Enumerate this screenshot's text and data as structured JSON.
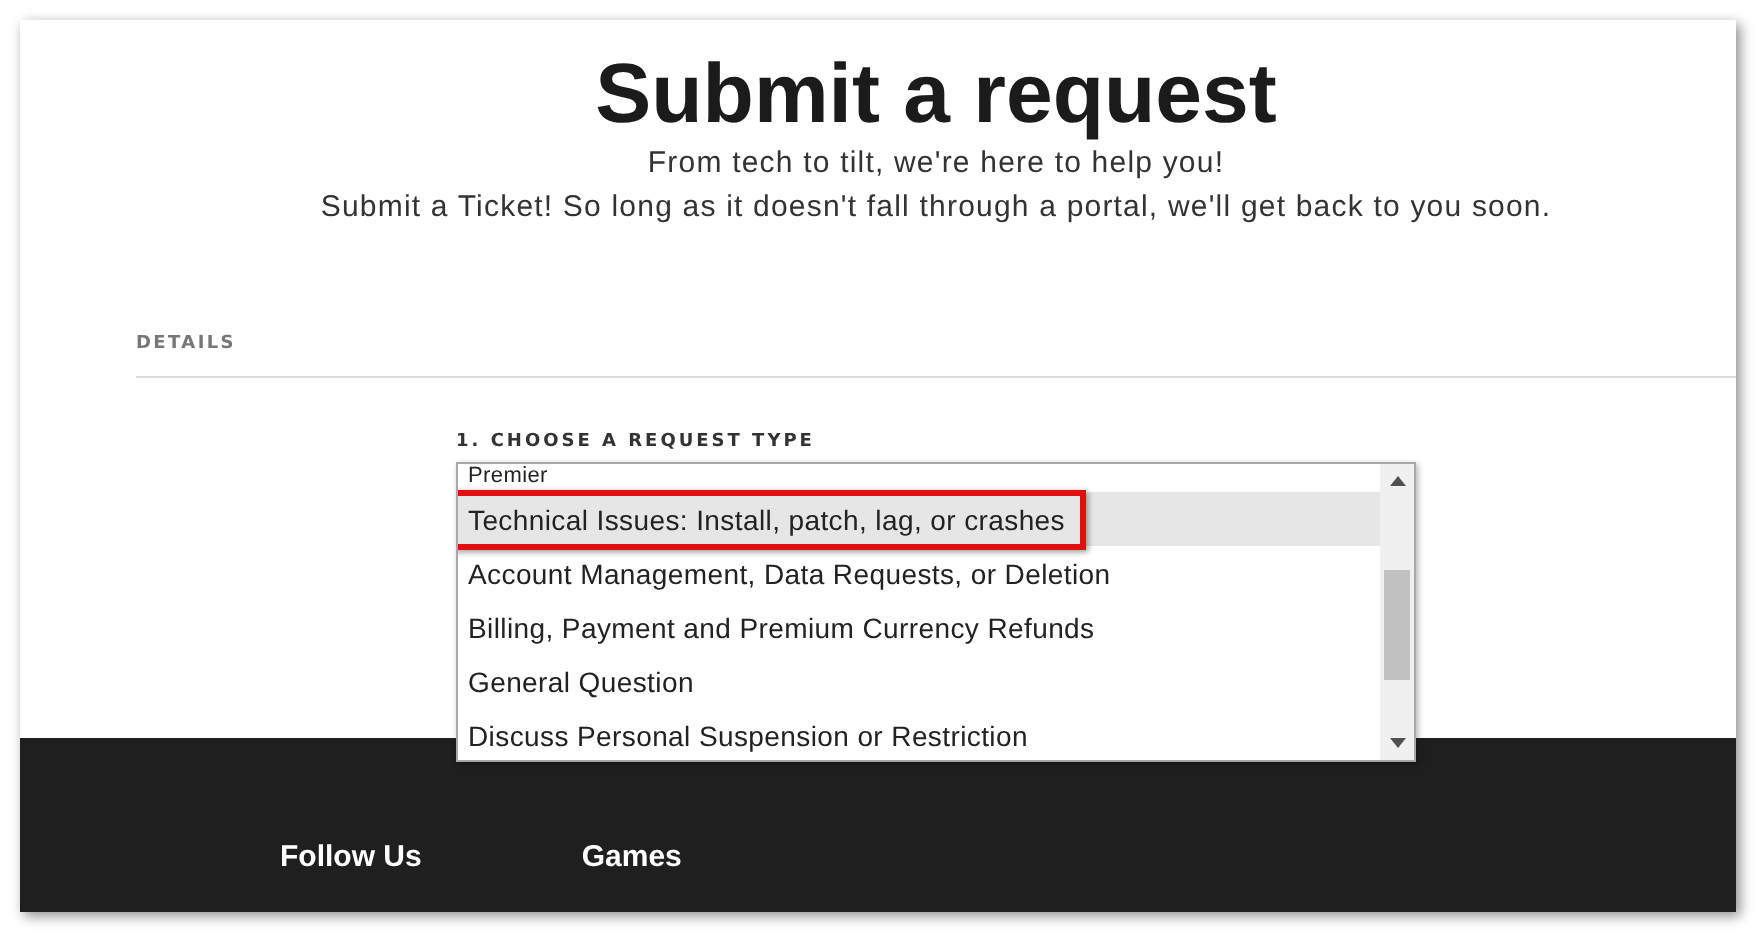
{
  "title": "Submit a request",
  "subtitle_lines": [
    "From tech to tilt, we're here to help you!",
    "Submit a Ticket! So long as it doesn't fall through a portal, we'll get back to you soon."
  ],
  "section_heading": "DETAILS",
  "request_type": {
    "label": "1. CHOOSE A REQUEST TYPE",
    "options": [
      {
        "label": "Premier",
        "selected": false,
        "highlighted": false
      },
      {
        "label": "Technical Issues: Install, patch, lag, or crashes",
        "selected": true,
        "highlighted": true
      },
      {
        "label": "Account Management, Data Requests, or Deletion",
        "selected": false,
        "highlighted": false
      },
      {
        "label": "Billing, Payment and Premium Currency Refunds",
        "selected": false,
        "highlighted": false
      },
      {
        "label": "General Question",
        "selected": false,
        "highlighted": false
      },
      {
        "label": "Discuss Personal Suspension or Restriction",
        "selected": false,
        "highlighted": false
      }
    ]
  },
  "footer": {
    "headings": [
      "Follow Us",
      "Games"
    ]
  }
}
